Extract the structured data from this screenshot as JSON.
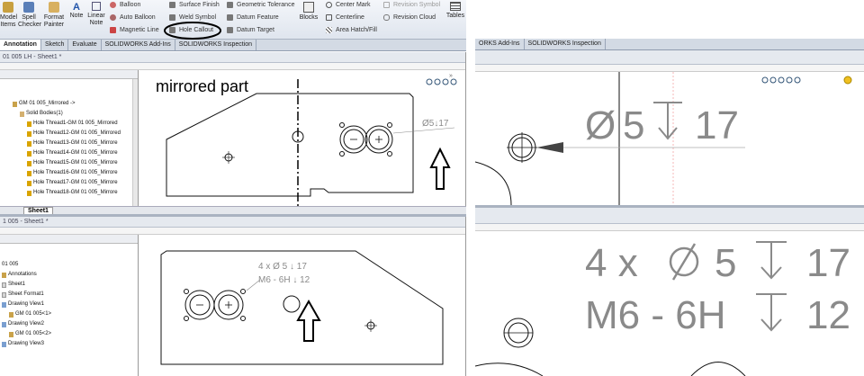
{
  "ribbon": {
    "buttons": [
      "Model Items",
      "Spell Checker",
      "Format Painter",
      "Note",
      "Linear Note"
    ],
    "col1": [
      "Balloon",
      "Auto Balloon",
      "Magnetic Line"
    ],
    "col2": [
      "Surface Finish",
      "Weld Symbol",
      "Hole Callout"
    ],
    "col3": [
      "Geometric Tolerance",
      "Datum Feature",
      "Datum Target"
    ],
    "blocks": "Blocks",
    "col4": [
      "Center Mark",
      "Centerline",
      "Area Hatch/Fill"
    ],
    "col5": [
      "Revision Symbol",
      "Revision Cloud"
    ],
    "tables": "Tables"
  },
  "tabs": [
    "Annotation",
    "Sketch",
    "Evaluate",
    "SOLIDWORKS Add-Ins",
    "SOLIDWORKS Inspection"
  ],
  "right_tabs": [
    "ORKS Add-Ins",
    "SOLIDWORKS Inspection"
  ],
  "top_window_title": "01 005 LH - Sheet1 *",
  "bottom_window_title": "1 005 - Sheet1 *",
  "top_tree": {
    "items": [
      "GM 01 005_Mirrored ->",
      "Solid Bodies(1)",
      "Hole Thread1-GM 01 005_Mirrored",
      "Hole Thread12-GM 01 005_Mirrored",
      "Hole Thread13-GM 01 005_Mirrore",
      "Hole Thread14-GM 01 005_Mirrore",
      "Hole Thread15-GM 01 005_Mirrore",
      "Hole Thread16-GM 01 005_Mirrore",
      "Hole Thread17-GM 01 005_Mirrore",
      "Hole Thread18-GM 01 005_Mirrore"
    ]
  },
  "sheet_tab": "Sheet1",
  "bottom_tree": {
    "items": [
      "01 005",
      "Annotations",
      "Sheet1",
      "Sheet Format1",
      "Drawing View1",
      "GM 01 005<1>",
      "Drawing View2",
      "GM 01 005<2>",
      "Drawing View3"
    ]
  },
  "annotation": {
    "mirrored_label": "mirrored part"
  },
  "callouts": {
    "top_small": "Ø5↓17",
    "bottom_small_line1": "4 x Ø 5 ↓ 17",
    "bottom_small_line2": "M6 - 6H ↓ 12",
    "zoom_top_dia": "Ø",
    "zoom_top_num": "5",
    "zoom_top_depth": "17",
    "zoom_bottom_count": "4 x",
    "zoom_bottom_dia_val": "5",
    "zoom_bottom_depth": "17",
    "zoom_bottom_thread": "M6 - 6H",
    "zoom_bottom_thread_depth": "12"
  },
  "colors": {
    "callout_gray": "#8a8a8a",
    "highlight_oval": "#000000",
    "ribbon_bg": "#e3e8ef"
  }
}
